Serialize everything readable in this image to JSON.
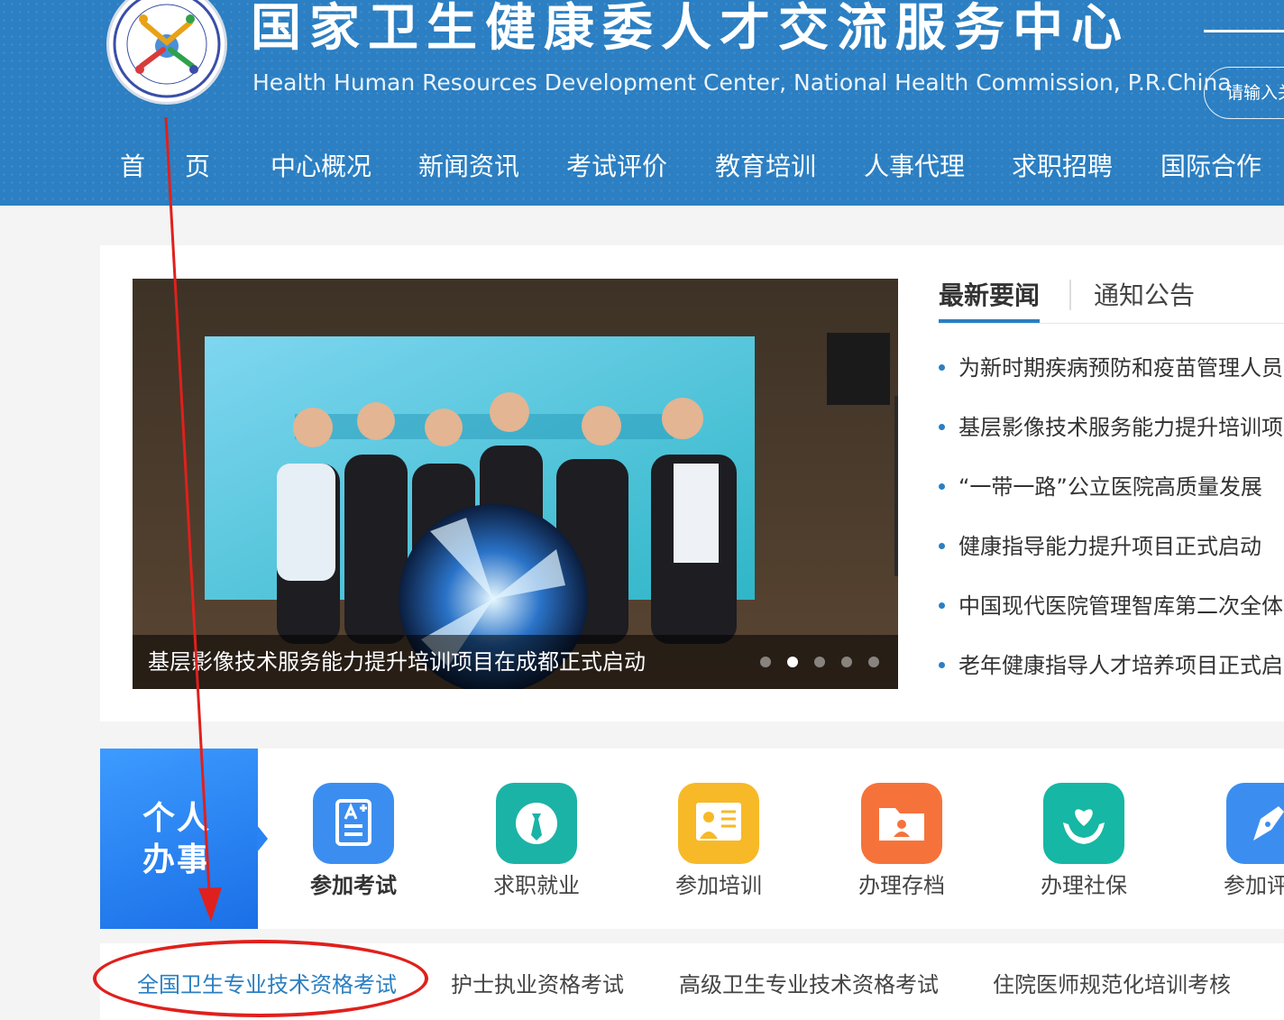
{
  "header": {
    "title_cn": "国家卫生健康委人才交流服务中心",
    "title_en": "Health Human Resources Development Center, National Health Commission, P.R.China",
    "search_placeholder": "请输入关键字",
    "brand_color": "#2b7fc2"
  },
  "nav": {
    "items": [
      {
        "label": "首",
        "label2": "页"
      },
      {
        "label": "中心概况"
      },
      {
        "label": "新闻资讯"
      },
      {
        "label": "考试评价"
      },
      {
        "label": "教育培训"
      },
      {
        "label": "人事代理"
      },
      {
        "label": "求职招聘"
      },
      {
        "label": "国际合作"
      }
    ]
  },
  "banner": {
    "caption": "基层影像技术服务能力提升培训项目在成都正式启动",
    "active_slide": 2,
    "slide_count": 5
  },
  "news": {
    "tabs": [
      {
        "label": "最新要闻",
        "active": true
      },
      {
        "label": "通知公告",
        "active": false
      }
    ],
    "items": [
      "为新时期疾病预防和疫苗管理人员",
      "基层影像技术服务能力提升培训项",
      "“一带一路”公立医院高质量发展",
      "健康指导能力提升项目正式启动",
      "中国现代医院管理智库第二次全体",
      "老年健康指导人才培养项目正式启"
    ]
  },
  "services": {
    "panel_label_line1": "个人",
    "panel_label_line2": "办事",
    "items": [
      {
        "label": "参加考试",
        "icon": "exam-icon",
        "color": "#3b8ef0",
        "active": true
      },
      {
        "label": "求职就业",
        "icon": "job-tie-icon",
        "color": "#1bb3a6",
        "active": false
      },
      {
        "label": "参加培训",
        "icon": "training-board-icon",
        "color": "#f7b928",
        "active": false
      },
      {
        "label": "办理存档",
        "icon": "archive-folder-icon",
        "color": "#f5733a",
        "active": false
      },
      {
        "label": "办理社保",
        "icon": "social-security-icon",
        "color": "#16b7a4",
        "active": false
      },
      {
        "label": "参加评",
        "icon": "pen-icon",
        "color": "#3b8ef0",
        "active": false
      }
    ]
  },
  "exams": {
    "items": [
      {
        "label": "全国卫生专业技术资格考试",
        "active": true
      },
      {
        "label": "护士执业资格考试",
        "active": false
      },
      {
        "label": "高级卫生专业技术资格考试",
        "active": false
      },
      {
        "label": "住院医师规范化培训考核",
        "active": false
      }
    ]
  },
  "annotation": {
    "color": "#e0201c"
  }
}
